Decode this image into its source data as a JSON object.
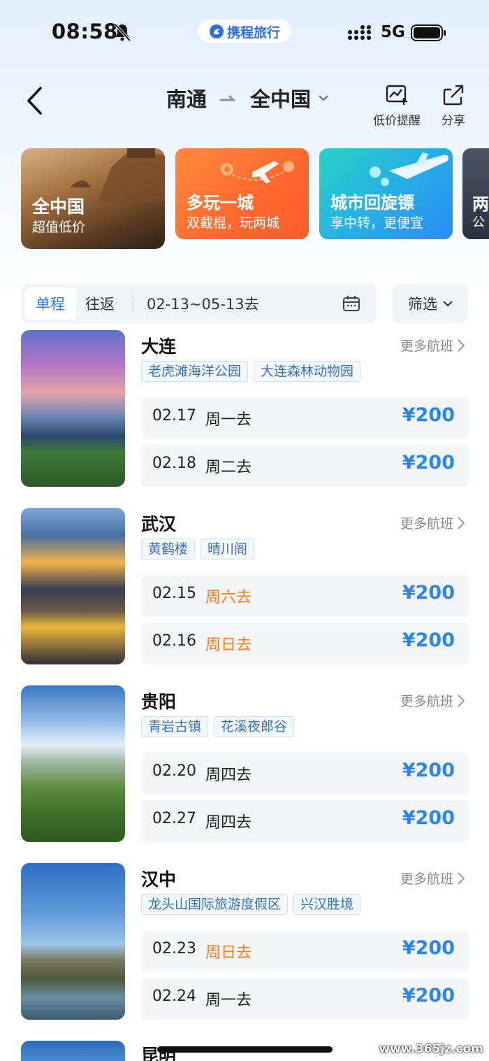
{
  "status_bar": {
    "time": "08:58",
    "network": "5G",
    "brand": "携程旅行"
  },
  "nav": {
    "origin": "南通",
    "destination": "全中国",
    "price_alert_label": "低价提醒",
    "share_label": "分享"
  },
  "banners": [
    {
      "title": "全中国",
      "subtitle": "超值低价"
    },
    {
      "title": "多玩一城",
      "subtitle": "双截棍，玩两城"
    },
    {
      "title": "城市回旋镖",
      "subtitle": "享中转，更便宜"
    },
    {
      "title": "两",
      "subtitle": "公"
    }
  ],
  "trip_filter": {
    "one_way": "单程",
    "round_trip": "往返",
    "date_range": "02-13~05-13去",
    "filter": "筛选"
  },
  "more_flights_label": "更多航班",
  "destinations": [
    {
      "name": "大连",
      "tags": [
        "老虎滩海洋公园",
        "大连森林动物园"
      ],
      "flights": [
        {
          "date": "02.17",
          "day": "周一去",
          "price": "¥200"
        },
        {
          "date": "02.18",
          "day": "周二去",
          "price": "¥200"
        }
      ]
    },
    {
      "name": "武汉",
      "tags": [
        "黄鹤楼",
        "晴川阁"
      ],
      "flights": [
        {
          "date": "02.15",
          "day": "周六去",
          "price": "¥200"
        },
        {
          "date": "02.16",
          "day": "周日去",
          "price": "¥200"
        }
      ]
    },
    {
      "name": "贵阳",
      "tags": [
        "青岩古镇",
        "花溪夜郎谷"
      ],
      "flights": [
        {
          "date": "02.20",
          "day": "周四去",
          "price": "¥200"
        },
        {
          "date": "02.27",
          "day": "周四去",
          "price": "¥200"
        }
      ]
    },
    {
      "name": "汉中",
      "tags": [
        "龙头山国际旅游度假区",
        "兴汉胜境"
      ],
      "flights": [
        {
          "date": "02.23",
          "day": "周日去",
          "price": "¥200"
        },
        {
          "date": "02.24",
          "day": "周一去",
          "price": "¥200"
        }
      ]
    }
  ],
  "next_destination_partial": "昆明",
  "watermark": "www.365jz.com",
  "colors": {
    "accent": "#2a86e8",
    "weekend": "#ff7a1a",
    "tag_text": "#3a6fb8"
  }
}
